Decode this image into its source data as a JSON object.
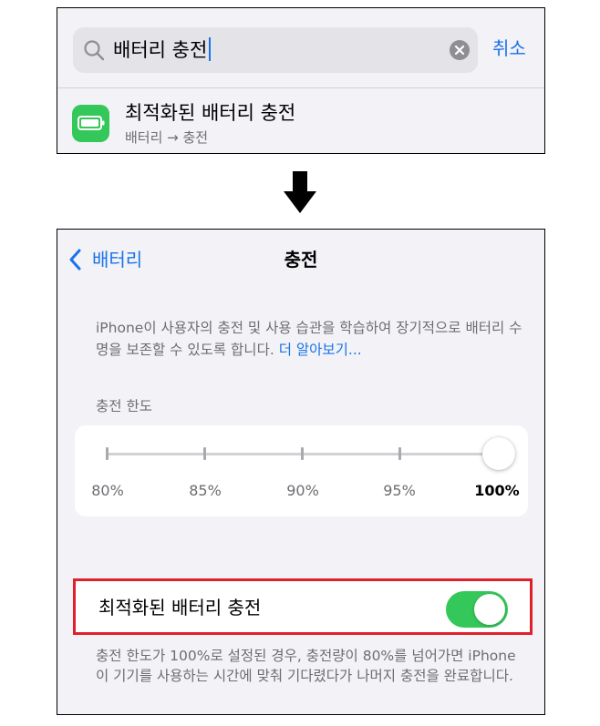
{
  "search": {
    "query": "배터리 충전",
    "cancel_label": "취소",
    "icon": "search-icon",
    "clear_icon": "clear-icon"
  },
  "search_result": {
    "title": "최적화된 배터리 충전",
    "path": "배터리 → 충전",
    "icon": "battery-icon",
    "icon_color": "#34C759"
  },
  "arrow": "arrow-down-icon",
  "nav": {
    "back_label": "배터리",
    "title": "충전"
  },
  "description": {
    "text": "iPhone이 사용자의 충전 및 사용 습관을 학습하여 장기적으로 배터리 수명을 보존할 수 있도록 합니다. ",
    "link": "더 알아보기..."
  },
  "charge_limit": {
    "header": "충전 한도",
    "ticks": [
      "80%",
      "85%",
      "90%",
      "95%",
      "100%"
    ],
    "selected": "100%"
  },
  "optimized_charging": {
    "label": "최적화된 배터리 충전",
    "enabled": true,
    "highlight_color": "#E0202A"
  },
  "footer": {
    "text": "충전 한도가 100%로 설정된 경우, 충전량이 80%를 넘어가면 iPhone이 기기를 사용하는 시간에 맞춰 기다렸다가 나머지 충전을 완료합니다."
  },
  "colors": {
    "accent": "#1A73E8",
    "toggle_on": "#34C759",
    "background": "#F2F2F7"
  }
}
